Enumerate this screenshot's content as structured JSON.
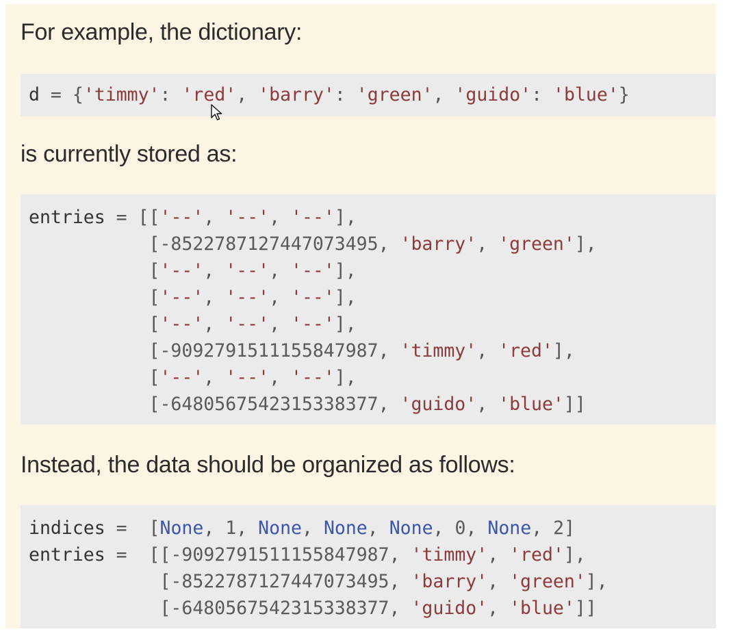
{
  "paragraphs": {
    "p1": "For example, the dictionary:",
    "p2": "is currently stored as:",
    "p3": "Instead, the data should be organized as follows:"
  },
  "code_blocks": {
    "dict": [
      "d = {'timmy': 'red', 'barry': 'green', 'guido': 'blue'}"
    ],
    "current_storage": [
      "entries = [['--', '--', '--'],",
      "           [-8522787127447073495, 'barry', 'green'],",
      "           ['--', '--', '--'],",
      "           ['--', '--', '--'],",
      "           ['--', '--', '--'],",
      "           [-9092791511155847987, 'timmy', 'red'],",
      "           ['--', '--', '--'],",
      "           [-6480567542315338377, 'guido', 'blue']]"
    ],
    "proposed_storage": [
      "indices =  [None, 1, None, None, None, 0, None, 2]",
      "entries =  [[-9092791511155847987, 'timmy', 'red'],",
      "            [-8522787127447073495, 'barry', 'green'],",
      "            [-6480567542315338377, 'guido', 'blue']]"
    ]
  },
  "colors": {
    "background": "#fdf5e3",
    "code_background": "#ebebeb",
    "string": "#8e3a3a",
    "keyword": "#3d56a8",
    "text": "#2b2b2b"
  },
  "icons": {
    "cursor": "mouse-pointer-icon"
  }
}
